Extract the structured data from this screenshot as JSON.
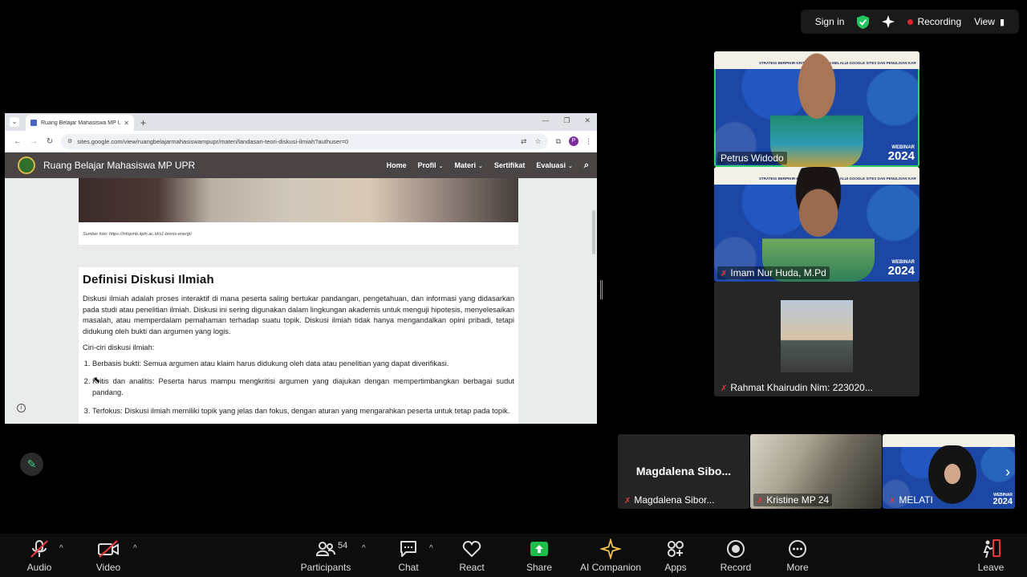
{
  "topbar": {
    "sign_in": "Sign in",
    "recording": "Recording",
    "view": "View"
  },
  "browser": {
    "tab_title": "Ruang Belajar Mahasiswa MP UPR",
    "url": "sites.google.com/view/ruangbelajarmahasiswampupr/materi/landasan-teori-diskusi-ilmiah?authuser=0",
    "profile_initial": "P"
  },
  "site": {
    "title": "Ruang Belajar Mahasiswa MP UPR",
    "nav": [
      {
        "label": "Home",
        "dropdown": false
      },
      {
        "label": "Profil",
        "dropdown": true
      },
      {
        "label": "Materi",
        "dropdown": true
      },
      {
        "label": "Sertifikat",
        "dropdown": false
      },
      {
        "label": "Evaluasi",
        "dropdown": true
      }
    ]
  },
  "article": {
    "photo_caption": "Sumber foto: https://infopmb.itpln.ac.id/s1-bisnis-energi/",
    "heading": "Definisi Diskusi Ilmiah",
    "paragraph": "Diskusi ilmiah adalah proses interaktif di mana peserta saling bertukar pandangan, pengetahuan, dan informasi yang didasarkan pada studi atau penelitian ilmiah. Diskusi ini sering digunakan dalam lingkungan akademis untuk menguji hipotesis, menyelesaikan masalah, atau memperdalam pemahaman terhadap suatu topik. Diskusi ilmiah tidak hanya mengandalkan opini pribadi, tetapi didukung oleh bukti dan argumen yang logis.",
    "list_intro": "Ciri-ciri diskusi ilmiah:",
    "items": [
      "Berbasis bukti: Semua argumen atau klaim harus didukung oleh data atau penelitian yang dapat diverifikasi.",
      "Kritis dan analitis: Peserta harus mampu mengkritisi argumen yang diajukan dengan mempertimbangkan berbagai sudut pandang.",
      "Terfokus: Diskusi ilmiah memiliki topik yang jelas dan fokus, dengan aturan yang mengarahkan peserta untuk tetap pada topik."
    ]
  },
  "participants": {
    "main": [
      {
        "name": "Petrus Widodo",
        "banner": "STRATEGI BERPIKIR KRITIS ... MASALAH MELALUI GOOGLE SITES DAN PENULISAN KARYA TULIS ILMIAH",
        "webinar": "WEBINAR",
        "year": "2024"
      },
      {
        "name": "Imam Nur Huda, M.Pd",
        "banner": "STRATEGI BERPIKIR KRITIS ... MASALAH MELALUI GOOGLE SITES DAN PENULISAN KARYA TULIS ILMIAH",
        "webinar": "WEBINAR",
        "year": "2024"
      },
      {
        "name": "Rahmat Khairudin Nim: 223020..."
      }
    ],
    "strip": [
      {
        "name": "Magdalena Sibor...",
        "display": "Magdalena  Sibo..."
      },
      {
        "name": "Kristine MP 24"
      },
      {
        "name": "MELATI",
        "webinar": "WEBINAR",
        "year": "2024"
      }
    ]
  },
  "toolbar": {
    "audio": "Audio",
    "video": "Video",
    "participants": "Participants",
    "participants_count": "54",
    "chat": "Chat",
    "react": "React",
    "share": "Share",
    "ai_companion": "AI Companion",
    "apps": "Apps",
    "record": "Record",
    "more": "More",
    "leave": "Leave"
  },
  "colors": {
    "share_green": "#1fbe4a",
    "record_red": "#e0242b",
    "active_speaker": "#2fd06a"
  }
}
